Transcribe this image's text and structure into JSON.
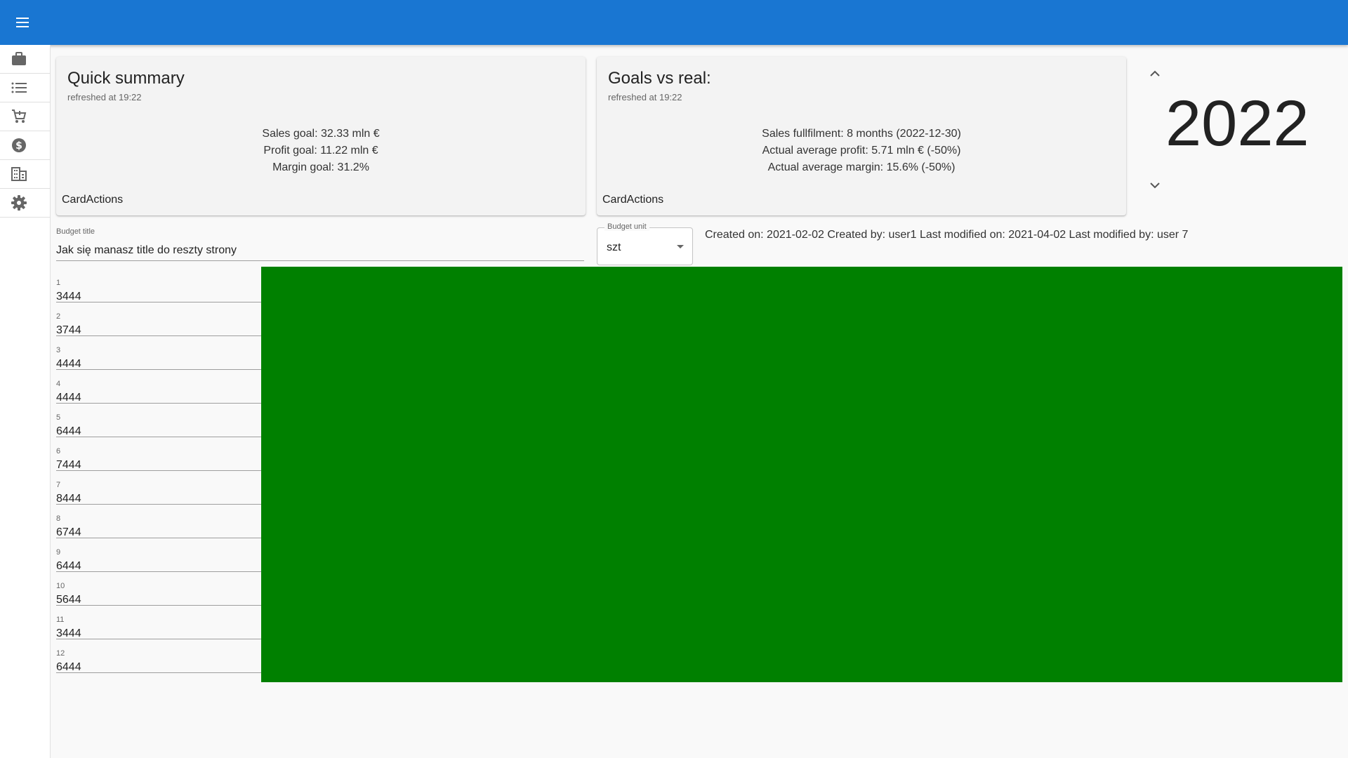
{
  "sidebar": {
    "items": [
      {
        "icon": "briefcase-icon"
      },
      {
        "icon": "list-icon"
      },
      {
        "icon": "cart-icon"
      },
      {
        "icon": "dollar-icon"
      },
      {
        "icon": "building-icon"
      },
      {
        "icon": "gear-icon"
      }
    ]
  },
  "colors": {
    "appbar": "#1976d2",
    "chart_fill": "#008000"
  },
  "quick_summary": {
    "title": "Quick summary",
    "refreshed": "refreshed at 19:22",
    "lines": [
      "Sales goal: 32.33 mln €",
      "Profit goal: 11.22 mln €",
      "Margin goal: 31.2%"
    ],
    "actions": "CardActions"
  },
  "goals_vs_real": {
    "title": "Goals vs real:",
    "refreshed": "refreshed at 19:22",
    "lines": [
      "Sales fullfilment: 8 months (2022-12-30)",
      "Actual average profit: 5.71 mln € (-50%)",
      "Actual average margin: 15.6% (-50%)"
    ],
    "actions": "CardActions"
  },
  "year": {
    "value": "2022"
  },
  "budget_title": {
    "label": "Budget title",
    "value": "Jak się manasz title do reszty strony"
  },
  "budget_unit": {
    "label": "Budget unit",
    "value": "szt"
  },
  "meta": "Created on: 2021-02-02 Created by: user1 Last modified on: 2021-04-02 Last modified by: user 7",
  "months": [
    {
      "label": "1",
      "value": "3444"
    },
    {
      "label": "2",
      "value": "3744"
    },
    {
      "label": "3",
      "value": "4444"
    },
    {
      "label": "4",
      "value": "4444"
    },
    {
      "label": "5",
      "value": "6444"
    },
    {
      "label": "6",
      "value": "7444"
    },
    {
      "label": "7",
      "value": "8444"
    },
    {
      "label": "8",
      "value": "6744"
    },
    {
      "label": "9",
      "value": "6444"
    },
    {
      "label": "10",
      "value": "5644"
    },
    {
      "label": "11",
      "value": "3444"
    },
    {
      "label": "12",
      "value": "6444"
    }
  ]
}
